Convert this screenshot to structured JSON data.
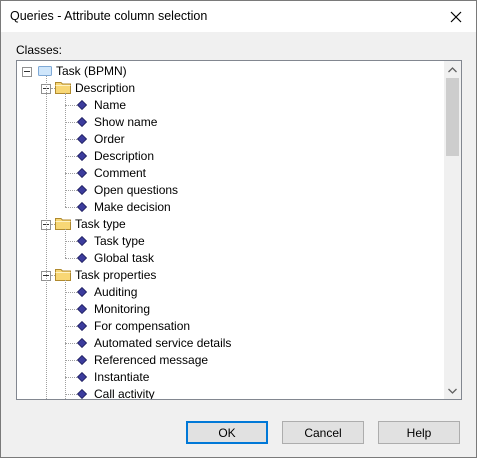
{
  "window": {
    "title": "Queries - Attribute column selection"
  },
  "classes_label": "Classes:",
  "tree": {
    "root": "Task (BPMN)",
    "groups": [
      {
        "label": "Description",
        "items": [
          "Name",
          "Show name",
          "Order",
          "Description",
          "Comment",
          "Open questions",
          "Make decision"
        ]
      },
      {
        "label": "Task type",
        "items": [
          "Task type",
          "Global task"
        ]
      },
      {
        "label": "Task properties",
        "items": [
          "Auditing",
          "Monitoring",
          "For compensation",
          "Automated service details",
          "Referenced message",
          "Instantiate",
          "Call activity"
        ]
      }
    ]
  },
  "buttons": {
    "ok": "OK",
    "cancel": "Cancel",
    "help": "Help"
  },
  "colors": {
    "selection_border": "#0078d7",
    "folder_fill": "#f8d775",
    "diamond_fill": "#3c3c9c"
  }
}
